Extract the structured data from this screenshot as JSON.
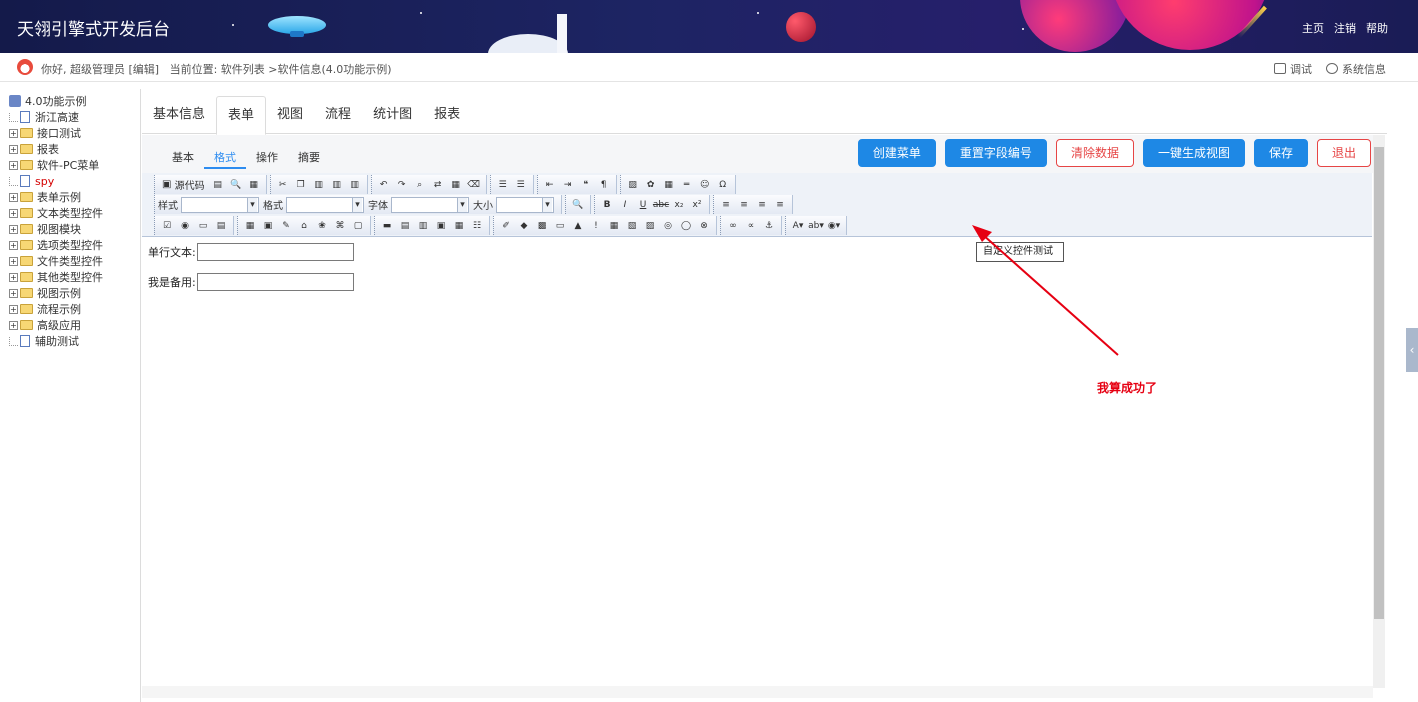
{
  "header": {
    "title": "天翎引擎式开发后台",
    "nav": [
      "主页",
      "注销",
      "帮助"
    ]
  },
  "infobar": {
    "greeting": "你好, 超级管理员 [编辑]",
    "location": "当前位置: 软件列表 >软件信息(4.0功能示例)",
    "debug": "调试",
    "sysinfo": "系统信息"
  },
  "tree": [
    {
      "label": "4.0功能示例",
      "kind": "root"
    },
    {
      "label": "浙江高速",
      "kind": "page"
    },
    {
      "label": "接口测试",
      "kind": "folder"
    },
    {
      "label": "报表",
      "kind": "folder"
    },
    {
      "label": "软件-PC菜单",
      "kind": "folder"
    },
    {
      "label": "spy",
      "kind": "page",
      "red": true
    },
    {
      "label": "表单示例",
      "kind": "folder"
    },
    {
      "label": "文本类型控件",
      "kind": "folder"
    },
    {
      "label": "视图模块",
      "kind": "folder"
    },
    {
      "label": "选项类型控件",
      "kind": "folder"
    },
    {
      "label": "文件类型控件",
      "kind": "folder"
    },
    {
      "label": "其他类型控件",
      "kind": "folder"
    },
    {
      "label": "视图示例",
      "kind": "folder"
    },
    {
      "label": "流程示例",
      "kind": "folder"
    },
    {
      "label": "高级应用",
      "kind": "folder"
    },
    {
      "label": "辅助测试",
      "kind": "page"
    }
  ],
  "tabs": [
    "基本信息",
    "表单",
    "视图",
    "流程",
    "统计图",
    "报表"
  ],
  "subtabs": [
    "基本",
    "格式",
    "操作",
    "摘要"
  ],
  "actions": {
    "create_menu": "创建菜单",
    "reset_field_no": "重置字段编号",
    "clear_data": "清除数据",
    "gen_view": "一键生成视图",
    "save": "保存",
    "exit": "退出"
  },
  "toolbar": {
    "source": "源代码",
    "style_label": "样式",
    "format_label": "格式",
    "font_label": "字体",
    "size_label": "大小"
  },
  "form": {
    "field1_label": "单行文本:",
    "field2_label": "我是备用:"
  },
  "tooltip": "自定义控件测试",
  "annotation": "我算成功了",
  "colors": {
    "primary": "#1e88e5",
    "danger": "#e64545",
    "annotation": "#e60012",
    "header": "#1d2463"
  }
}
